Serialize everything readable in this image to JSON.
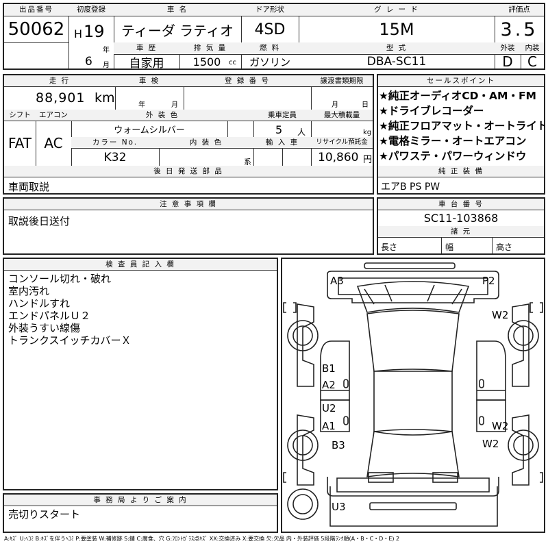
{
  "header": {
    "lot_no_label": "出品番号",
    "lot_no": "50062",
    "first_reg_label": "初度登録",
    "era_letter": "H",
    "era_year": "19",
    "year_unit": "年",
    "month": "6",
    "month_unit": "月",
    "car_name_label": "車 名",
    "car_name": "ティーダ ラティオ",
    "door_label": "ドア形状",
    "door": "4SD",
    "grade_label": "グ レ ー ド",
    "grade": "15M",
    "score_label": "評価点",
    "score": "3.5",
    "history_label": "車 歴",
    "history": "自家用",
    "displacement_label": "排 気 量",
    "displacement": "1500",
    "displacement_unit": "cc",
    "fuel_label": "燃 料",
    "fuel": "ガソリン",
    "model_label": "型 式",
    "model": "DBA-SC11",
    "exterior_label": "外装",
    "interior_label": "内装",
    "exterior_grade": "D",
    "interior_grade": "C"
  },
  "row2": {
    "mileage_label": "走 行",
    "mileage": "88,901",
    "mileage_unit": "km",
    "inspection_label": "車 検",
    "inspection_year": "年",
    "inspection_month": "月",
    "reg_no_label": "登 録 番 号",
    "transfer_label": "譲渡書類期限",
    "transfer_month": "月",
    "transfer_day": "日",
    "shift_label": "シフト",
    "shift": "FAT",
    "ac_label": "エアコン",
    "ac": "AC",
    "color_label": "外 装 色",
    "color": "ウォームシルバー",
    "capacity_label": "乗車定員",
    "capacity": "5",
    "capacity_unit": "人",
    "payload_label": "最大積載量",
    "payload_unit": "kg",
    "color_no_label": "カラー No.",
    "color_no": "K32",
    "int_color_label": "内 装 色",
    "int_color_unit": "系",
    "import_label": "輸 入 車",
    "recycle_label": "リサイクル預託金",
    "recycle": "10,860",
    "recycle_unit": "円",
    "later_label": "後 日 発 送 部 品",
    "later": "車両取説"
  },
  "sales": {
    "label": "セールスポイント",
    "points": [
      "★純正オーディオCD・AM・FM",
      "★ドライブレコーダー",
      "★純正フロアマット・オートライト",
      "★電格ミラー・オートエアコン",
      "★パワステ・パワーウィンドウ"
    ],
    "equip_label": "純 正 装 備",
    "equip": "エアB PS PW"
  },
  "notes": {
    "label": "注 意 事 項 欄",
    "text": "取説後日送付"
  },
  "chassis": {
    "label": "車 台 番 号",
    "value": "SC11-103868",
    "dims_label": "諸 元",
    "length_label": "長さ",
    "width_label": "幅",
    "height_label": "高さ"
  },
  "inspector": {
    "label": "検 査 員 記 入 欄",
    "lines": [
      "コンソール切れ・破れ",
      "室内汚れ",
      "ハンドルすれ",
      "エンドパネルＵ２",
      "外装うすい線傷",
      "トランクスイッチカバーＸ"
    ]
  },
  "office": {
    "label": "事 務 局 よ り ご 案 内",
    "text": "売切りスタート"
  },
  "diagram": {
    "marks": [
      "A3",
      "P2",
      "W2",
      "B1",
      "A2",
      "U2",
      "A1",
      "W2",
      "B3",
      "W2",
      "U3"
    ]
  },
  "legend": "A:ｷｽﾞ U:ﾍｺﾐ B:ｷｽﾞを伴うﾍｺﾐ P:要塗装 W:補修跡 S:錆 C:腐食、穴 G:ﾌﾛﾝﾄｶﾞﾗｽ点ｷｽﾞ XX:交換済み X:要交換 欠:欠品 内・外装評価 5段階ﾗﾝｸ順(A・B・C・D・E) 2"
}
